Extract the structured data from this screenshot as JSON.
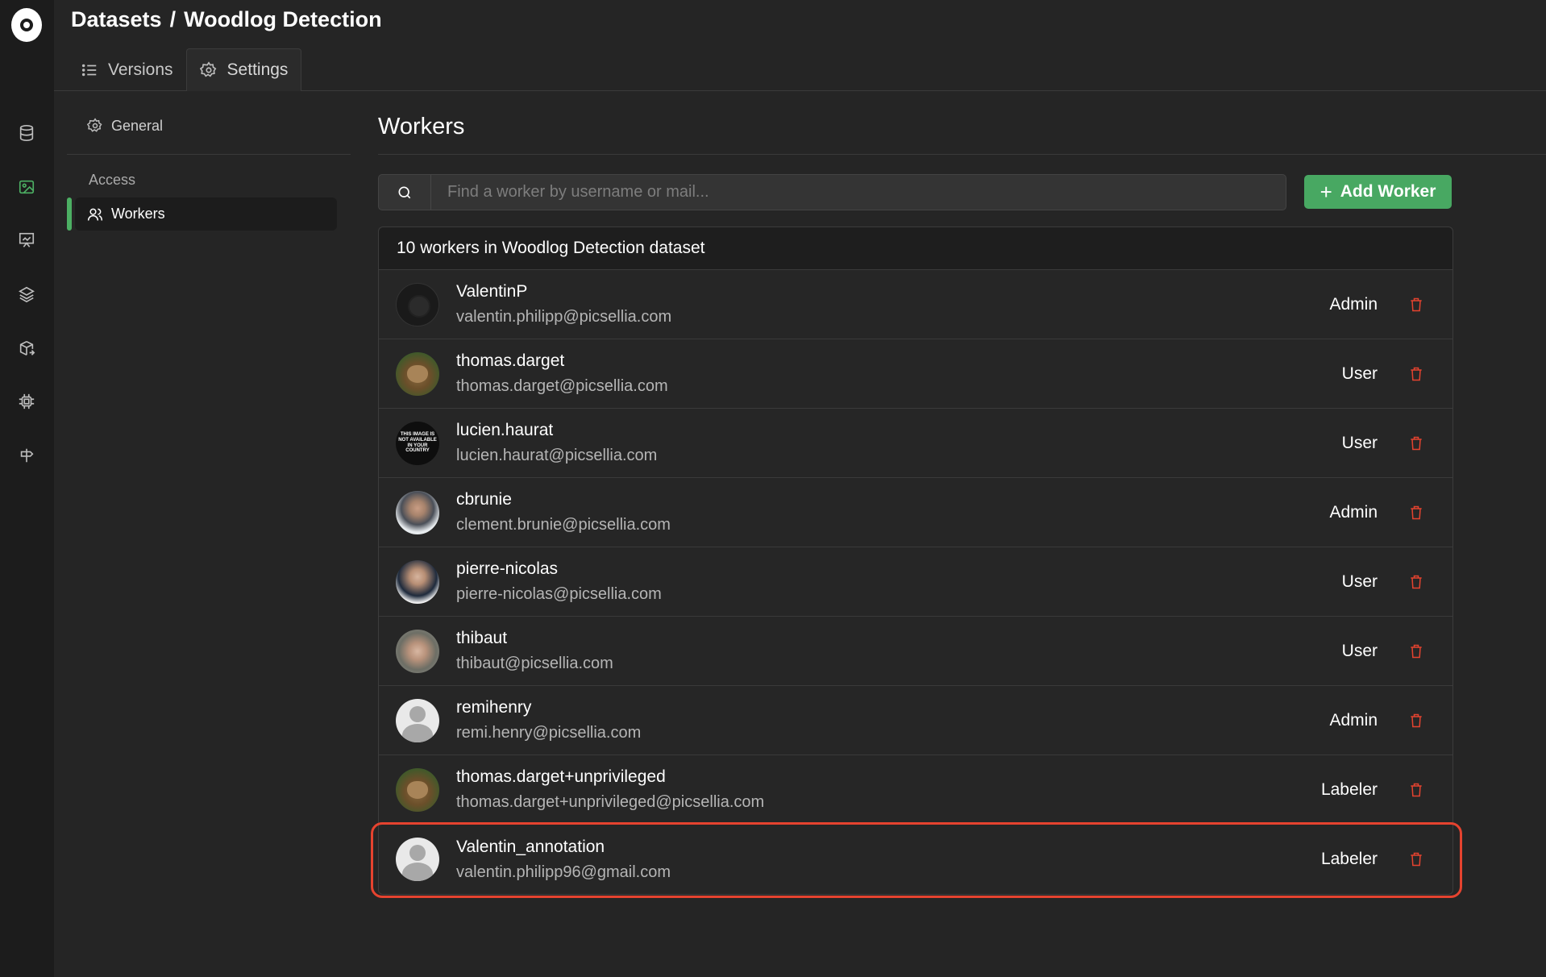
{
  "breadcrumb": {
    "root": "Datasets",
    "separator": "/",
    "current": "Woodlog Detection"
  },
  "tabs": [
    {
      "label": "Versions",
      "icon": "list-icon",
      "active": false
    },
    {
      "label": "Settings",
      "icon": "gear-icon",
      "active": true
    }
  ],
  "rail": [
    "database-icon",
    "image-icon",
    "easel-icon",
    "layers-icon",
    "box-arrow-icon",
    "chip-icon",
    "signpost-icon"
  ],
  "side": {
    "general_label": "General",
    "access_section": "Access",
    "workers_label": "Workers"
  },
  "main": {
    "title": "Workers",
    "search_placeholder": "Find a worker by username or mail...",
    "add_button": "Add Worker",
    "table_header": "10 workers in Woodlog Detection dataset"
  },
  "workers": [
    {
      "name": "ValentinP",
      "email": "valentin.philipp@picsellia.com",
      "role": "Admin"
    },
    {
      "name": "thomas.darget",
      "email": "thomas.darget@picsellia.com",
      "role": "User"
    },
    {
      "name": "lucien.haurat",
      "email": "lucien.haurat@picsellia.com",
      "role": "User",
      "avatar_text": "THIS IMAGE IS NOT AVAILABLE IN YOUR COUNTRY"
    },
    {
      "name": "cbrunie",
      "email": "clement.brunie@picsellia.com",
      "role": "Admin"
    },
    {
      "name": "pierre-nicolas",
      "email": "pierre-nicolas@picsellia.com",
      "role": "User"
    },
    {
      "name": "thibaut",
      "email": "thibaut@picsellia.com",
      "role": "User"
    },
    {
      "name": "remihenry",
      "email": "remi.henry@picsellia.com",
      "role": "Admin"
    },
    {
      "name": "thomas.darget+unprivileged",
      "email": "thomas.darget+unprivileged@picsellia.com",
      "role": "Labeler"
    },
    {
      "name": "Valentin_annotation",
      "email": "valentin.philipp96@gmail.com",
      "role": "Labeler"
    }
  ],
  "colors": {
    "accent": "#48a862",
    "danger": "#e5432f",
    "background": "#252525",
    "rail": "#1c1c1c"
  }
}
